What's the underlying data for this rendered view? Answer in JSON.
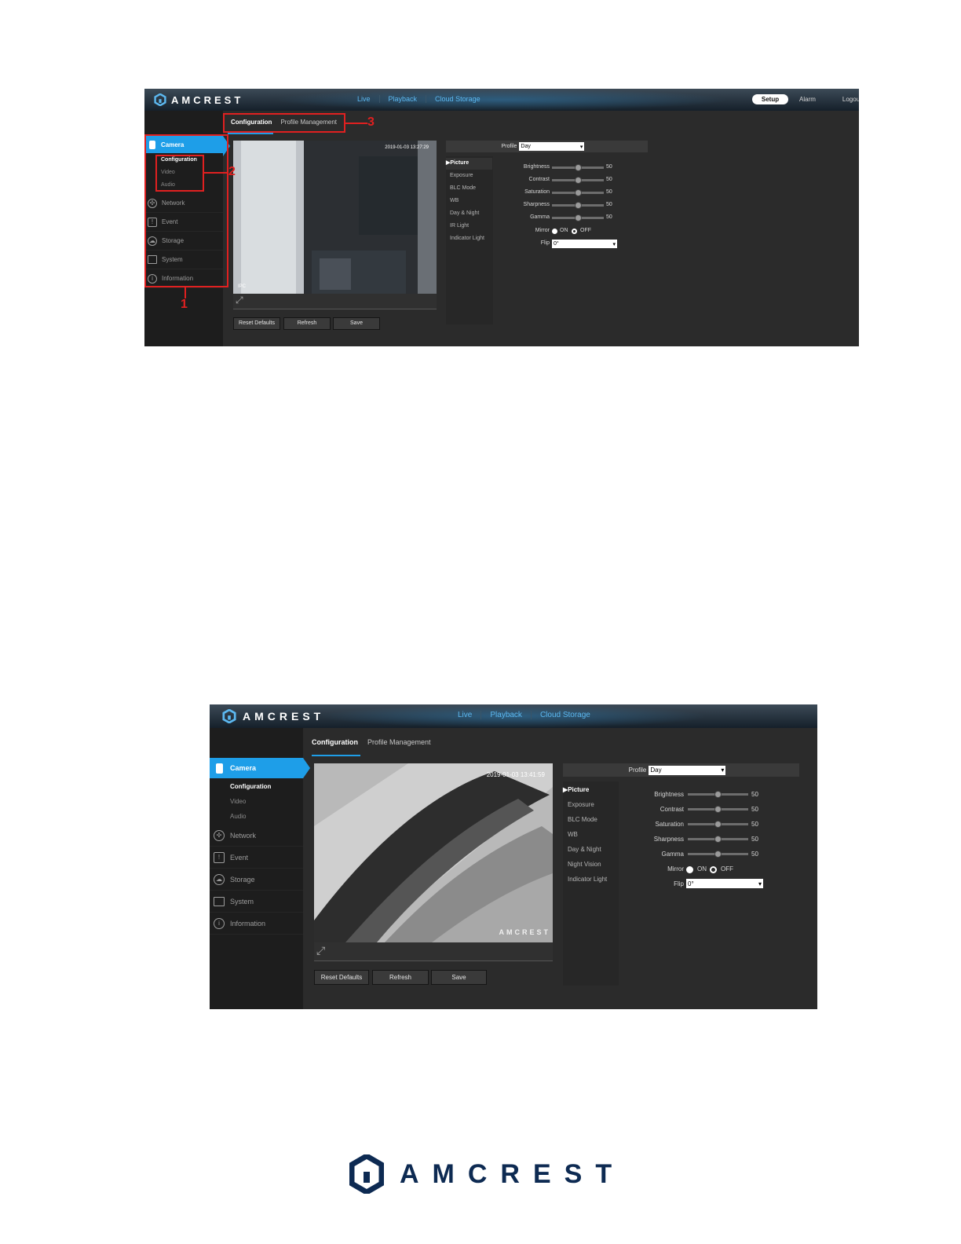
{
  "brand": "AMCREST",
  "nav": [
    "Live",
    "Playback",
    "Cloud Storage"
  ],
  "right_nav": {
    "setup": "Setup",
    "alarm": "Alarm",
    "logout": "Logout"
  },
  "tabs": {
    "configuration": "Configuration",
    "profile_management": "Profile Management"
  },
  "sidebar": {
    "active": "Camera",
    "subitems": [
      "Configuration",
      "Video",
      "Audio"
    ],
    "items": [
      "Network",
      "Event",
      "Storage",
      "System",
      "Information"
    ]
  },
  "screenshot1": {
    "timestamp": "2019-01-03 13:27:29",
    "video_corner_label": "IPC",
    "menu": [
      "▶Picture",
      "Exposure",
      "BLC Mode",
      "WB",
      "Day & Night",
      "IR Light",
      "Indicator Light"
    ],
    "annotations": [
      "1",
      "2",
      "3"
    ]
  },
  "screenshot2": {
    "timestamp": "2019-01-03 13:41:59",
    "watermark": "AMCREST",
    "menu": [
      "▶Picture",
      "Exposure",
      "BLC Mode",
      "WB",
      "Day & Night",
      "Night Vision",
      "Indicator Light"
    ]
  },
  "settings": {
    "profile_label": "Profile",
    "profile_value": "Day",
    "sliders": [
      {
        "label": "Brightness",
        "value": "50"
      },
      {
        "label": "Contrast",
        "value": "50"
      },
      {
        "label": "Saturation",
        "value": "50"
      },
      {
        "label": "Sharpness",
        "value": "50"
      },
      {
        "label": "Gamma",
        "value": "50"
      }
    ],
    "mirror_label": "Mirror",
    "mirror_on": "ON",
    "mirror_off": "OFF",
    "mirror_selected": "OFF",
    "flip_label": "Flip",
    "flip_value": "0°"
  },
  "buttons": {
    "reset": "Reset Defaults",
    "refresh": "Refresh",
    "save": "Save"
  }
}
